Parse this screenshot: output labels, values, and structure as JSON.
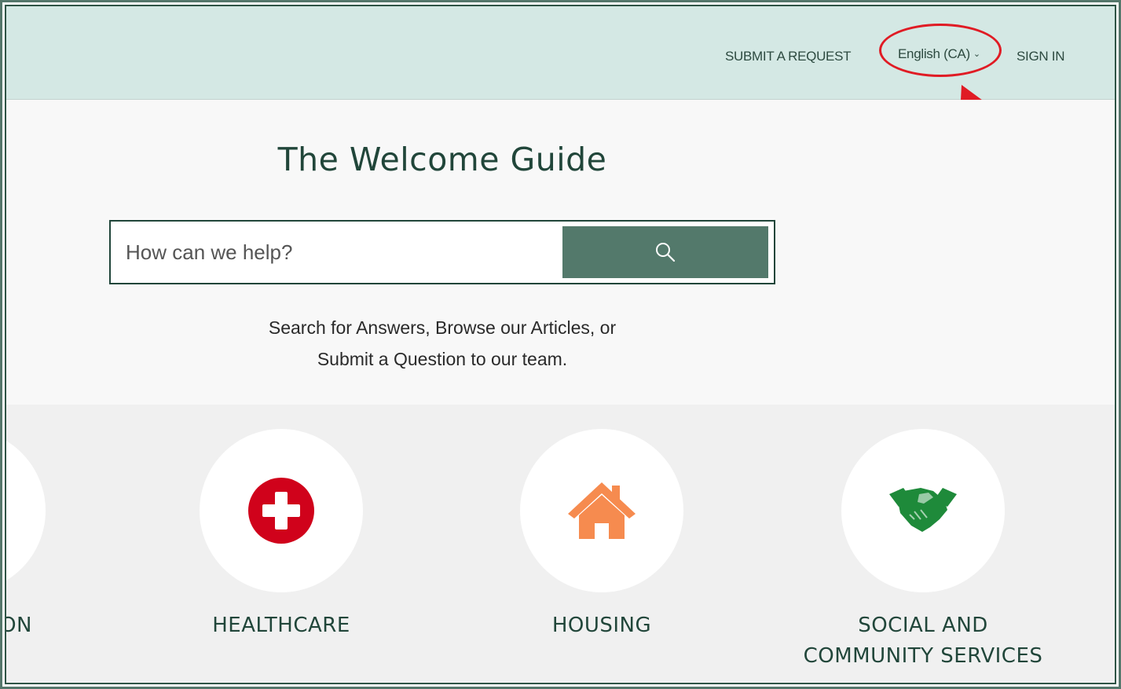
{
  "header": {
    "submit_request": "SUBMIT A REQUEST",
    "language": "English (CA)",
    "sign_in": "SIGN IN"
  },
  "hero": {
    "title": "The Welcome Guide",
    "search_placeholder": "How can we help?",
    "tagline_line1": "Search for Answers, Browse our Articles, or",
    "tagline_line2": "Submit a Question to our team."
  },
  "categories": [
    {
      "label": "ON",
      "icon": "partial-icon"
    },
    {
      "label": "HEALTHCARE",
      "icon": "medical-cross-icon"
    },
    {
      "label": "HOUSING",
      "icon": "house-icon"
    },
    {
      "label_line1": "SOCIAL AND",
      "label_line2": "COMMUNITY SERVICES",
      "icon": "handshake-icon"
    }
  ],
  "colors": {
    "header_bg": "#d4e8e4",
    "brand_green": "#21463a",
    "search_button": "#53796b",
    "annotation_red": "#e01b24",
    "healthcare_red": "#d0021b",
    "housing_orange": "#f68b4f",
    "handshake_green": "#1e8a3a"
  }
}
